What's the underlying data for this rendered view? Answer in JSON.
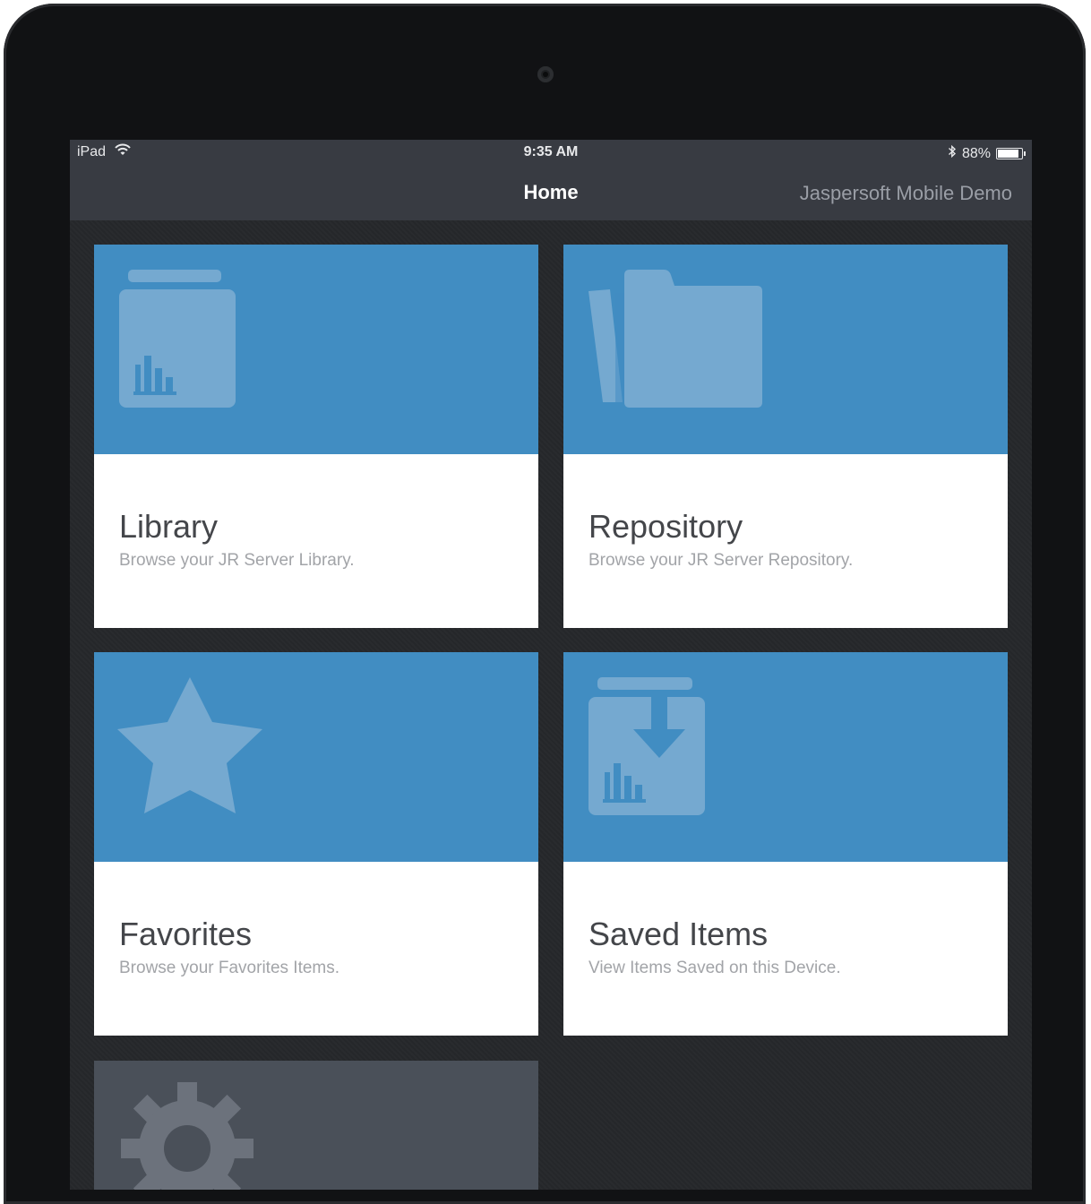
{
  "status_bar": {
    "device": "iPad",
    "time": "9:35 AM",
    "battery": "88%",
    "battery_level": 0.88
  },
  "nav": {
    "title": "Home",
    "server": "Jaspersoft Mobile Demo"
  },
  "tiles": [
    {
      "title": "Library",
      "subtitle": "Browse your JR Server Library.",
      "icon": "library-icon"
    },
    {
      "title": "Repository",
      "subtitle": "Browse your JR Server Repository.",
      "icon": "folder-icon"
    },
    {
      "title": "Favorites",
      "subtitle": "Browse your Favorites Items.",
      "icon": "star-icon"
    },
    {
      "title": "Saved Items",
      "subtitle": "View Items Saved on this Device.",
      "icon": "saved-download-icon"
    },
    {
      "title": "",
      "subtitle": "",
      "icon": "gear-icon"
    }
  ],
  "colors": {
    "tile_banner": "#418dc2",
    "icon_fill": "#75a9d0",
    "nav_background": "#383b42",
    "settings_tile": "#4a5059",
    "settings_icon": "#6c727c"
  }
}
